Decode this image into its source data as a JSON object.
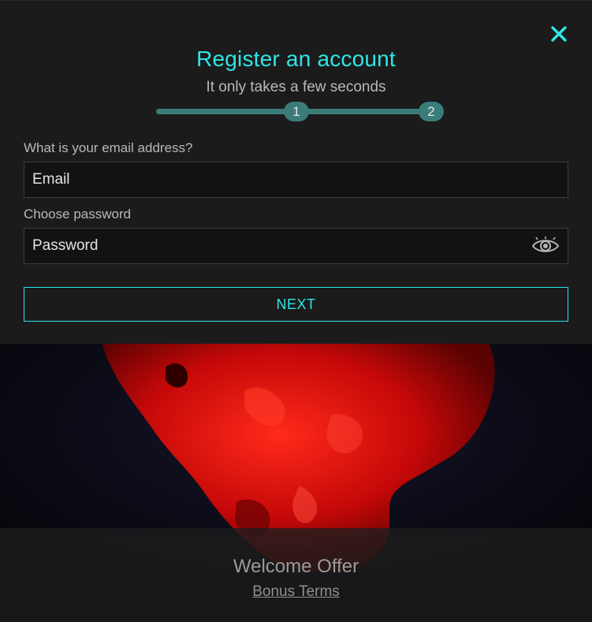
{
  "modal": {
    "title": "Register an account",
    "subtitle": "It only takes a few seconds",
    "close_icon": "close-icon",
    "progress": {
      "steps": [
        "1",
        "2"
      ],
      "current_step": 1
    }
  },
  "form": {
    "email_label": "What is your email address?",
    "email_placeholder": "Email",
    "password_label": "Choose password",
    "password_placeholder": "Password",
    "show_password_icon": "eye-icon",
    "next_label": "NEXT"
  },
  "footer": {
    "welcome": "Welcome Offer",
    "bonus_terms": "Bonus Terms"
  },
  "colors": {
    "accent": "#2ee6e6",
    "step": "#3a7c79",
    "background": "#1b1b1b",
    "hero_red": "#e01010"
  }
}
